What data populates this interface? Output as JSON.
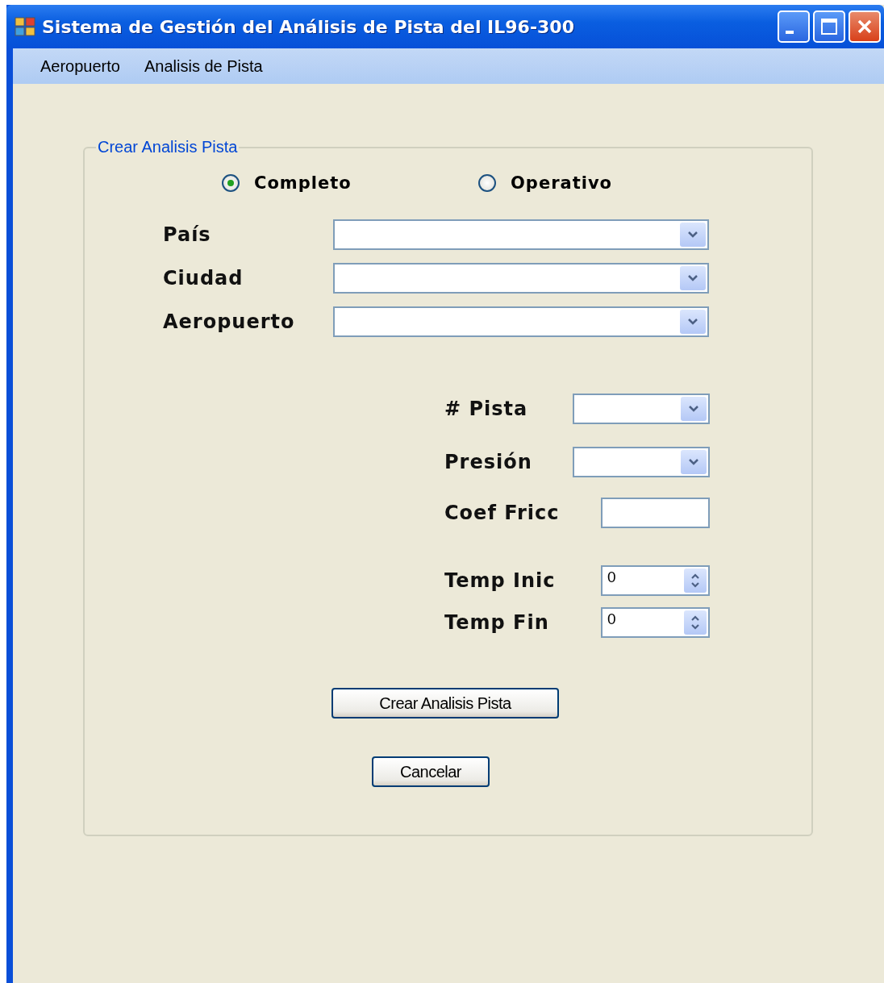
{
  "window": {
    "title": "Sistema de Gestión del Análisis de Pista del IL96-300"
  },
  "menu": [
    "Aeropuerto",
    "Analisis de Pista"
  ],
  "group": {
    "title": "Crear Analisis Pista"
  },
  "mode_options": [
    {
      "label": "Completo",
      "selected": true
    },
    {
      "label": "Operativo",
      "selected": false
    }
  ],
  "location_fields": [
    {
      "label": "País",
      "kind": "combo"
    },
    {
      "label": "Ciudad",
      "kind": "combo"
    },
    {
      "label": "Aeropuerto",
      "kind": "combo"
    }
  ],
  "detail_fields": [
    {
      "label": "# Pista",
      "kind": "combo"
    },
    {
      "label": "Presión",
      "kind": "combo"
    },
    {
      "label": "Coef Fricc",
      "kind": "text"
    },
    {
      "label": "Temp Inic",
      "kind": "spin",
      "value": "0"
    },
    {
      "label": "Temp Fin",
      "kind": "spin",
      "value": "0"
    }
  ],
  "buttons": [
    "Crear Analisis Pista",
    "Cancelar"
  ]
}
